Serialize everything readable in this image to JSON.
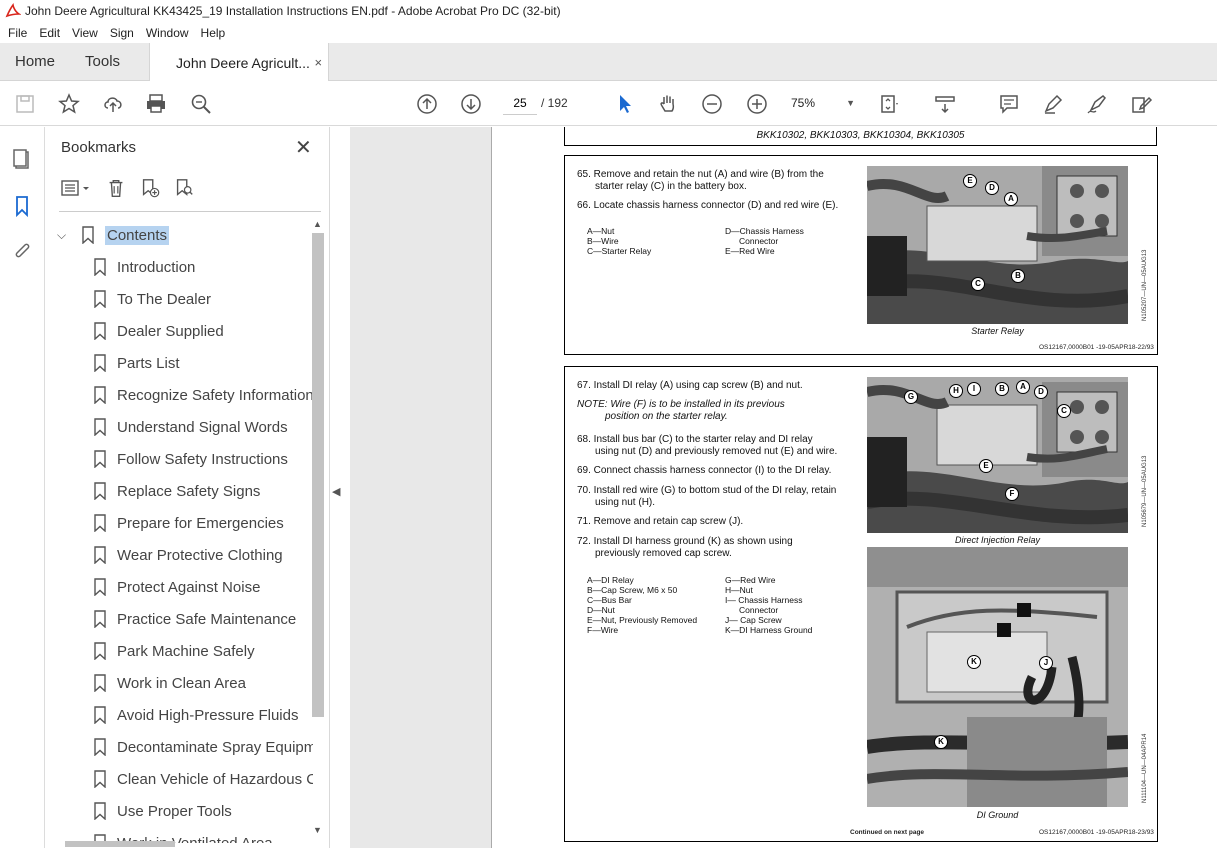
{
  "window": {
    "title": "John Deere Agricultural KK43425_19 Installation Instructions EN.pdf - Adobe Acrobat Pro DC (32-bit)"
  },
  "menu": [
    "File",
    "Edit",
    "View",
    "Sign",
    "Window",
    "Help"
  ],
  "tabs": {
    "home": "Home",
    "tools": "Tools",
    "document": "John Deere Agricult...",
    "close": "×"
  },
  "toolbar": {
    "page_current": "25",
    "page_total": "/ 192",
    "zoom": "75%"
  },
  "bookmarks": {
    "title": "Bookmarks",
    "close": "✕",
    "root": "Contents",
    "items": [
      "Introduction",
      "To The Dealer",
      "Dealer Supplied",
      "Parts List",
      "Recognize Safety Information",
      "Understand Signal Words",
      "Follow Safety Instructions",
      "Replace Safety Signs",
      "Prepare for Emergencies",
      "Wear Protective Clothing",
      "Protect Against Noise",
      "Practice Safe Maintenance",
      "Park Machine Safely",
      "Work in Clean Area",
      "Avoid High-Pressure Fluids",
      "Decontaminate Spray Equipment",
      "Clean Vehicle of Hazardous Chemicals",
      "Use Proper Tools",
      "Work in Ventilated Area"
    ]
  },
  "document": {
    "header_models": "BKK10302, BKK10303, BKK10304, BKK10305",
    "block1": {
      "step65": "65. Remove and retain the nut (A) and wire (B) from the",
      "step65b": "starter relay (C) in the battery box.",
      "step66": "66. Locate chassis harness connector (D) and red wire (E).",
      "legend_left": [
        "A—Nut",
        "B—Wire",
        "C—Starter Relay"
      ],
      "legend_right": [
        "D—Chassis Harness",
        "Connector",
        "E—Red Wire"
      ],
      "fig_caption": "Starter Relay",
      "fig_id": "N105207—UN—05AUG13",
      "footer": "OS12167,0000B01 -19-05APR18-22/93",
      "callouts": [
        "E",
        "D",
        "A",
        "B",
        "C"
      ]
    },
    "block2": {
      "step67": "67. Install DI relay (A) using cap screw (B) and nut.",
      "note1": "NOTE: Wire (F) is to be installed in its previous",
      "note2": "position on the starter relay.",
      "step68": "68. Install bus bar (C) to the starter relay and DI relay",
      "step68b": "using nut (D) and previously removed nut (E) and wire.",
      "step69": "69. Connect chassis harness connector (I) to the DI relay.",
      "step70": "70. Install red wire (G) to bottom stud of the DI relay, retain",
      "step70b": "using nut (H).",
      "step71": "71. Remove and retain cap screw (J).",
      "step72": "72. Install DI harness ground (K) as shown using",
      "step72b": "previously removed cap screw.",
      "legend_left": [
        "A—DI Relay",
        "B—Cap Screw, M6 x 50",
        "C—Bus Bar",
        "D—Nut",
        "E—Nut, Previously Removed",
        "F—Wire"
      ],
      "legend_right": [
        "G—Red Wire",
        "H—Nut",
        "I— Chassis Harness",
        "Connector",
        "J— Cap Screw",
        "K—DI Harness Ground"
      ],
      "fig1_caption": "Direct Injection Relay",
      "fig1_id": "N105679—UN—05AUG13",
      "fig2_caption": "DI Ground",
      "fig2_id": "N111104—UN—04APR14",
      "continued": "Continued on next page",
      "footer": "OS12167,0000B01 -19-05APR18-23/93",
      "callouts1": [
        "G",
        "H",
        "I",
        "B",
        "A",
        "D",
        "C",
        "E",
        "F"
      ],
      "callouts2": [
        "K",
        "J",
        "K"
      ]
    }
  }
}
